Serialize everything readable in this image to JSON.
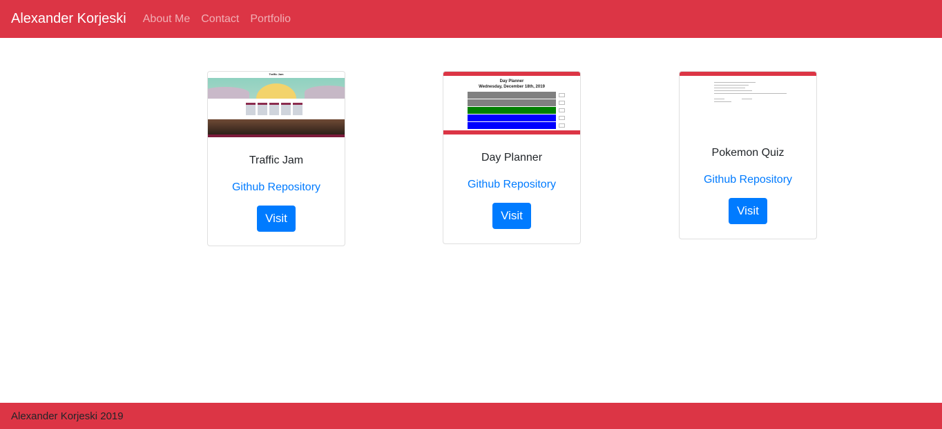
{
  "navbar": {
    "brand": "Alexander Korjeski",
    "links": [
      "About Me",
      "Contact",
      "Portfolio"
    ]
  },
  "projects": [
    {
      "title": "Traffic Jam",
      "repo_label": "Github Repository",
      "visit_label": "Visit",
      "thumb_text": "Traffic Jam"
    },
    {
      "title": "Day Planner",
      "repo_label": "Github Repository",
      "visit_label": "Visit",
      "thumb_title": "Day Planner",
      "thumb_subtitle": "Wednesday, December 18th, 2019"
    },
    {
      "title": "Pokemon Quiz",
      "repo_label": "Github Repository",
      "visit_label": "Visit"
    }
  ],
  "footer": {
    "text": "Alexander Korjeski 2019"
  },
  "colors": {
    "primary": "#dc3545",
    "link": "#007bff",
    "button": "#007bff"
  }
}
